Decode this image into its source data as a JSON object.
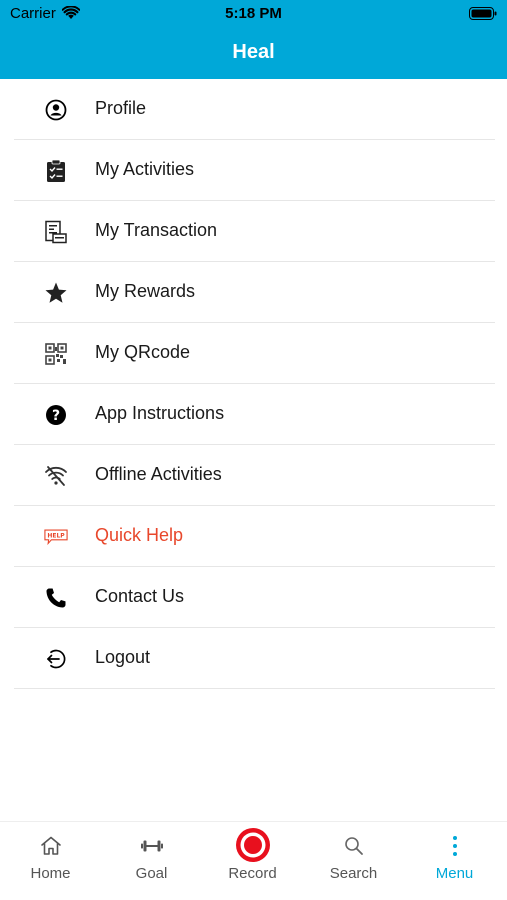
{
  "status_bar": {
    "carrier": "Carrier",
    "time": "5:18 PM"
  },
  "header": {
    "title": "Heal"
  },
  "menu": {
    "items": [
      {
        "label": "Profile",
        "icon": "profile-icon"
      },
      {
        "label": "My Activities",
        "icon": "clipboard-icon"
      },
      {
        "label": "My Transaction",
        "icon": "receipt-icon"
      },
      {
        "label": "My Rewards",
        "icon": "star-icon"
      },
      {
        "label": "My QRcode",
        "icon": "qrcode-icon"
      },
      {
        "label": "App Instructions",
        "icon": "question-icon"
      },
      {
        "label": "Offline Activities",
        "icon": "wifi-off-icon"
      },
      {
        "label": "Quick Help",
        "icon": "help-bubble-icon",
        "help_badge": "HELP"
      },
      {
        "label": "Contact Us",
        "icon": "phone-icon"
      },
      {
        "label": "Logout",
        "icon": "logout-icon"
      }
    ]
  },
  "tab_bar": {
    "tabs": [
      {
        "label": "Home",
        "icon": "home-icon"
      },
      {
        "label": "Goal",
        "icon": "dumbbell-icon"
      },
      {
        "label": "Record",
        "icon": "record-icon"
      },
      {
        "label": "Search",
        "icon": "search-icon"
      },
      {
        "label": "Menu",
        "icon": "more-vertical-icon",
        "active": true
      }
    ]
  },
  "colors": {
    "brand": "#00a8d8",
    "accent": "#e8472b",
    "record": "#e8101e"
  }
}
